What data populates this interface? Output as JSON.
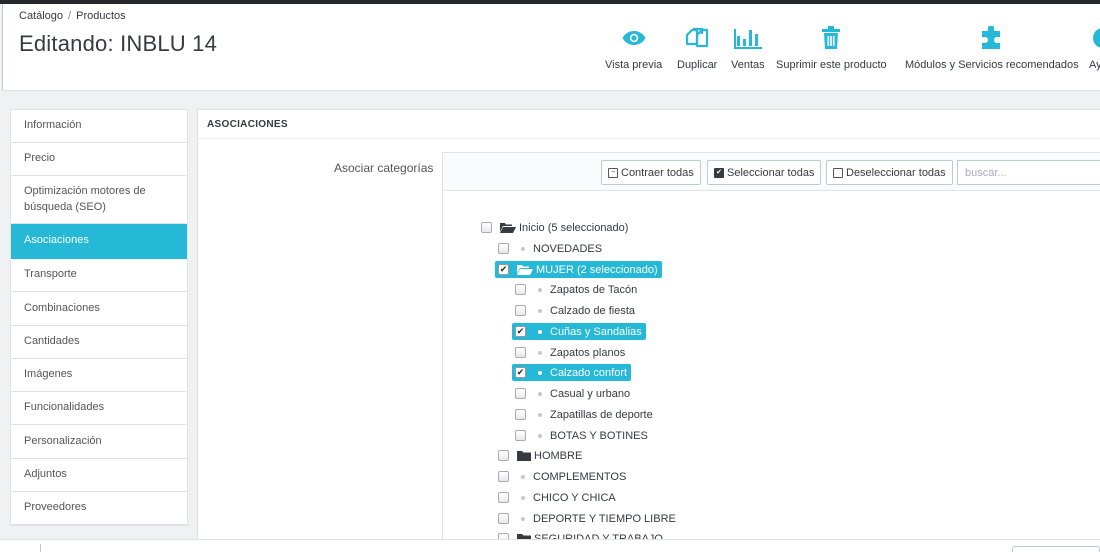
{
  "header": {
    "breadcrumb": [
      "Catálogo",
      "Productos"
    ],
    "title": "Editando: INBLU 14",
    "toolbar": [
      {
        "label": "Vista previa",
        "icon": "eye-icon"
      },
      {
        "label": "Duplicar",
        "icon": "copy-icon"
      },
      {
        "label": "Ventas",
        "icon": "bar-chart-icon"
      },
      {
        "label": "Suprimir este producto",
        "icon": "trash-icon"
      },
      {
        "label": "Módulos y Servicios recomendados",
        "icon": "puzzle-icon"
      },
      {
        "label": "Ay",
        "icon": "help-icon"
      }
    ],
    "accent_color": "#25b9d7"
  },
  "sidebar": {
    "items": [
      {
        "label": "Información",
        "active": false
      },
      {
        "label": "Precio",
        "active": false
      },
      {
        "label": "Optimización motores de búsqueda (SEO)",
        "active": false
      },
      {
        "label": "Asociaciones",
        "active": true
      },
      {
        "label": "Transporte",
        "active": false
      },
      {
        "label": "Combinaciones",
        "active": false
      },
      {
        "label": "Cantidades",
        "active": false
      },
      {
        "label": "Imágenes",
        "active": false
      },
      {
        "label": "Funcionalidades",
        "active": false
      },
      {
        "label": "Personalización",
        "active": false
      },
      {
        "label": "Adjuntos",
        "active": false
      },
      {
        "label": "Proveedores",
        "active": false
      }
    ]
  },
  "panel": {
    "heading": "ASOCIACIONES",
    "field_label": "Asociar categorías",
    "tree_toolbar": {
      "collapse_all": "Contraer todas",
      "select_all": "Seleccionar todas",
      "deselect_all": "Deseleccionar todas",
      "search_placeholder": "buscar..."
    },
    "tree": [
      {
        "label": "Inicio (5 seleccionado)",
        "level": 0,
        "type": "folder-open",
        "checked": false,
        "selected": false
      },
      {
        "label": "NOVEDADES",
        "level": 1,
        "type": "leaf",
        "checked": false,
        "selected": false
      },
      {
        "label": "MUJER (2 seleccionado)",
        "level": 1,
        "type": "folder-open",
        "checked": true,
        "selected": true
      },
      {
        "label": "Zapatos de Tacón",
        "level": 2,
        "type": "leaf",
        "checked": false,
        "selected": false
      },
      {
        "label": "Calzado de fiesta",
        "level": 2,
        "type": "leaf",
        "checked": false,
        "selected": false
      },
      {
        "label": "Cuñas y Sandalias",
        "level": 2,
        "type": "leaf",
        "checked": true,
        "selected": true
      },
      {
        "label": "Zapatos planos",
        "level": 2,
        "type": "leaf",
        "checked": false,
        "selected": false
      },
      {
        "label": "Calzado confort",
        "level": 2,
        "type": "leaf",
        "checked": true,
        "selected": true
      },
      {
        "label": "Casual y urbano",
        "level": 2,
        "type": "leaf",
        "checked": false,
        "selected": false
      },
      {
        "label": "Zapatillas de deporte",
        "level": 2,
        "type": "leaf",
        "checked": false,
        "selected": false
      },
      {
        "label": "BOTAS Y BOTINES",
        "level": 2,
        "type": "leaf",
        "checked": false,
        "selected": false
      },
      {
        "label": "HOMBRE",
        "level": 1,
        "type": "folder-closed",
        "checked": false,
        "selected": false
      },
      {
        "label": "COMPLEMENTOS",
        "level": 1,
        "type": "leaf",
        "checked": false,
        "selected": false
      },
      {
        "label": "CHICO Y CHICA",
        "level": 1,
        "type": "leaf",
        "checked": false,
        "selected": false
      },
      {
        "label": "DEPORTE Y TIEMPO LIBRE",
        "level": 1,
        "type": "leaf",
        "checked": false,
        "selected": false
      },
      {
        "label": "SEGURIDAD Y TRABAJO",
        "level": 1,
        "type": "folder-closed",
        "checked": false,
        "selected": false
      }
    ]
  }
}
